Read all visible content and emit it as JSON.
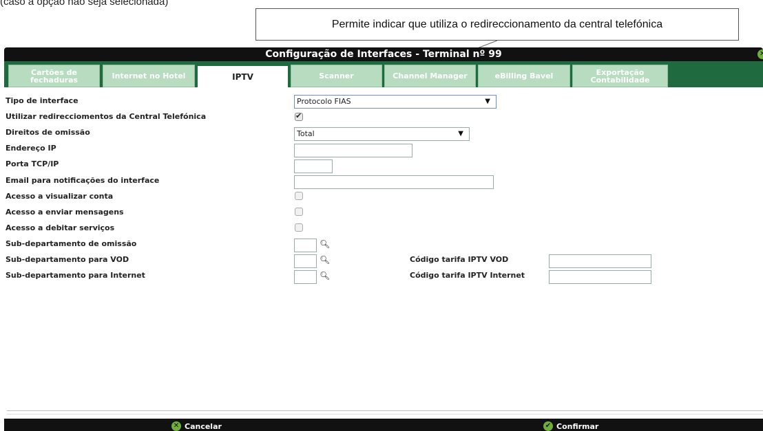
{
  "caption": {
    "text": "(caso a opção não seja selecionada)"
  },
  "callout": {
    "text": "Permite indicar que utiliza o redireccionamento da central telefónica"
  },
  "window": {
    "title": "Configuração de Interfaces - Terminal nº 99"
  },
  "tabs": [
    {
      "label": "Cartões de fechaduras",
      "active": false
    },
    {
      "label": "Internet no Hotel",
      "active": false
    },
    {
      "label": "IPTV",
      "active": true
    },
    {
      "label": "Scanner",
      "active": false
    },
    {
      "label": "Channel Manager",
      "active": false
    },
    {
      "label": "eBilling Bavel",
      "active": false
    },
    {
      "label": "Exportação Contabilidade",
      "active": false
    }
  ],
  "form": {
    "interface_type": {
      "label": "Tipo de interface",
      "value": "Protocolo FIAS"
    },
    "use_redirects": {
      "label": "Utilizar redirecciomentos da Central Telefónica",
      "checked": true
    },
    "default_rights": {
      "label": "Direitos de omissão",
      "value": "Total"
    },
    "ip_address": {
      "label": "Endereço IP",
      "value": ""
    },
    "tcp_port": {
      "label": "Porta TCP/IP",
      "value": ""
    },
    "notification_email": {
      "label": "Email para notificações do interface",
      "value": ""
    },
    "view_account": {
      "label": "Acesso a visualizar conta",
      "checked": false
    },
    "send_messages": {
      "label": "Acesso a enviar mensagens",
      "checked": false
    },
    "debit_services": {
      "label": "Acesso a debitar serviços",
      "checked": false
    },
    "default_subdept": {
      "label": "Sub-departamento de omissão",
      "value": ""
    },
    "vod_subdept": {
      "label": "Sub-departamento para VOD",
      "value": ""
    },
    "internet_subdept": {
      "label": "Sub-departamento para Internet",
      "value": ""
    },
    "vod_rate_code": {
      "label": "Código tarifa IPTV VOD",
      "value": ""
    },
    "internet_rate_code": {
      "label": "Código tarifa IPTV Internet",
      "value": ""
    }
  },
  "footer": {
    "cancel_label": "Cancelar",
    "confirm_label": "Confirmar"
  },
  "colors": {
    "tab_bar": "#1f6b3f",
    "tab_inactive": "#b7dcc0",
    "title_bar": "#111111",
    "accent_green": "#6fae3c"
  },
  "icons": {
    "close": "close-circle-icon",
    "search": "magnifier-icon",
    "cancel": "x-circle-icon",
    "confirm": "check-circle-icon"
  }
}
